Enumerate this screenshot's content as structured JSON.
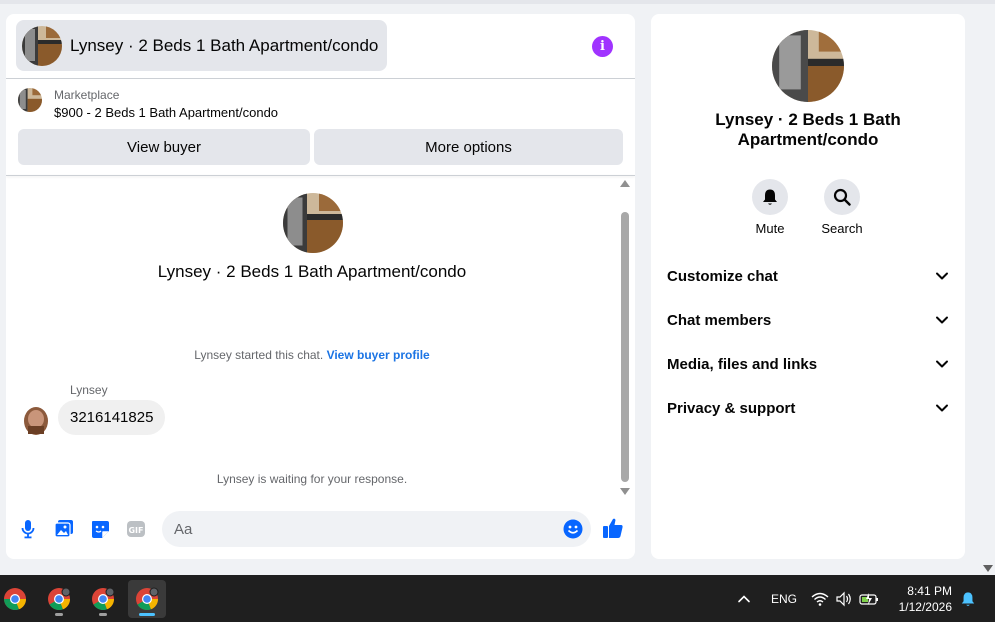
{
  "chat": {
    "header_title": "Lynsey · 2 Beds 1 Bath Apartment/condo",
    "marketplace_label": "Marketplace",
    "listing_title": "$900 - 2 Beds 1 Bath Apartment/condo",
    "view_buyer_label": "View buyer",
    "more_options_label": "More options",
    "center_name": "Lynsey · 2 Beds 1 Bath Apartment/condo",
    "started_text": "Lynsey started this chat. ",
    "view_buyer_profile_link": "View buyer profile",
    "sender_name": "Lynsey",
    "message_text": "3216141825",
    "waiting_text": "Lynsey is waiting for your response.",
    "composer_placeholder": "Aa"
  },
  "info_panel": {
    "name": "Lynsey · 2 Beds 1 Bath Apartment/condo",
    "mute_label": "Mute",
    "search_label": "Search",
    "items": [
      {
        "label": "Customize chat"
      },
      {
        "label": "Chat members"
      },
      {
        "label": "Media, files and links"
      },
      {
        "label": "Privacy & support"
      }
    ]
  },
  "taskbar": {
    "language": "ENG",
    "time": "8:41 PM",
    "date": "1/12/2026"
  },
  "colors": {
    "accent_blue": "#0866ff",
    "info_purple": "#a033ff",
    "link_blue": "#1b74e4"
  }
}
